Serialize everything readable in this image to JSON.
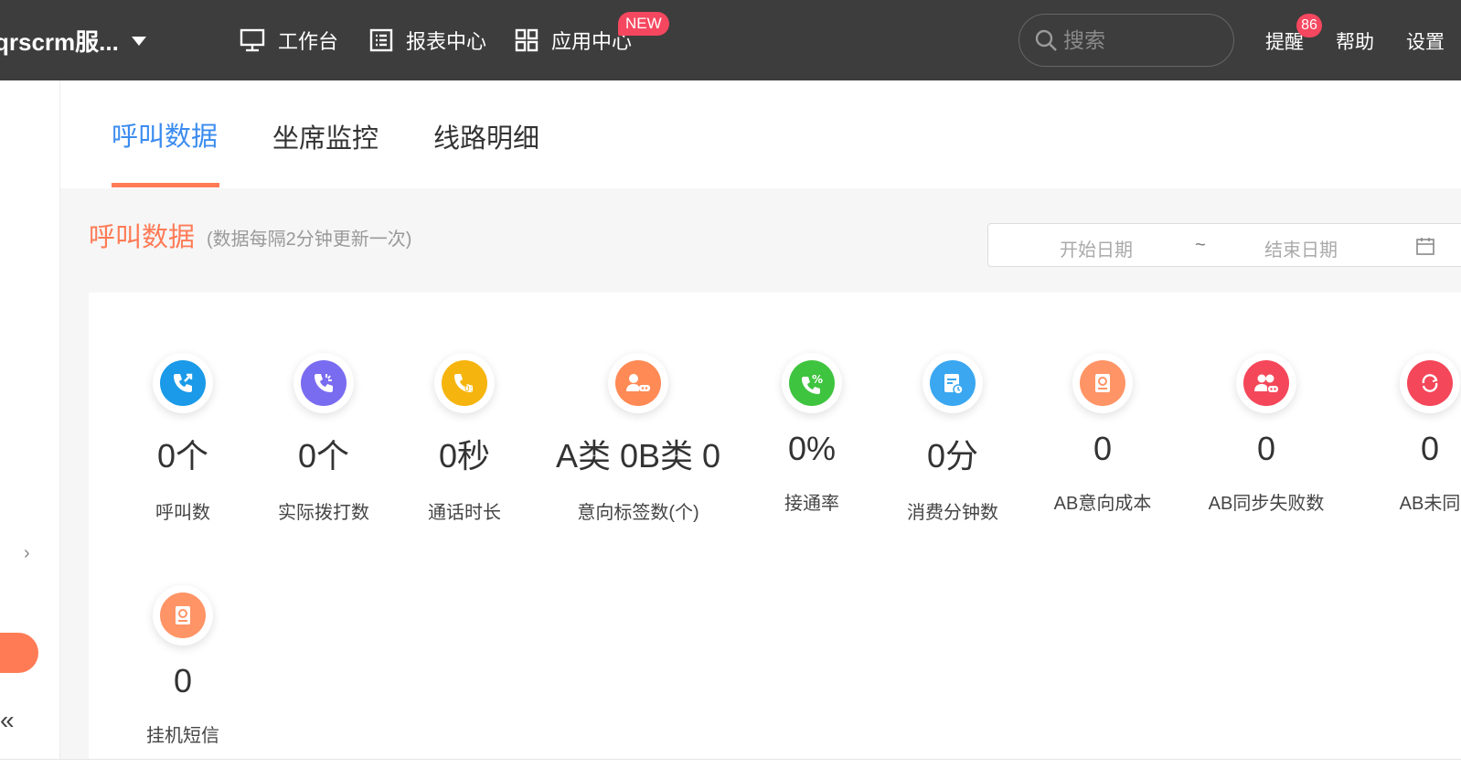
{
  "header": {
    "org_name": "qrscrm服...",
    "nav": [
      {
        "label": "工作台",
        "icon": "monitor-icon"
      },
      {
        "label": "报表中心",
        "icon": "report-icon"
      },
      {
        "label": "应用中心",
        "icon": "apps-grid-icon"
      }
    ],
    "new_badge": "NEW",
    "search_placeholder": "搜索",
    "reminder_label": "提醒",
    "reminder_count": "86",
    "help_label": "帮助",
    "settings_label": "设置"
  },
  "tabs": [
    {
      "label": "呼叫数据",
      "active": true
    },
    {
      "label": "坐席监控",
      "active": false
    },
    {
      "label": "线路明细",
      "active": false
    }
  ],
  "section": {
    "title": "呼叫数据",
    "note": "(数据每隔2分钟更新一次)",
    "start_date_placeholder": "开始日期",
    "separator": "~",
    "end_date_placeholder": "结束日期"
  },
  "stats": [
    {
      "value": "0个",
      "label": "呼叫数",
      "icon": "outgoing-call-icon",
      "color": "#1a9ae8"
    },
    {
      "value": "0个",
      "label": "实际拨打数",
      "icon": "dial-call-icon",
      "color": "#7a6cf0"
    },
    {
      "value": "0秒",
      "label": "通话时长",
      "icon": "call-duration-icon",
      "color": "#f6b40e"
    },
    {
      "value": "A类 0B类 0",
      "label": "意向标签数(个)",
      "icon": "user-tag-icon",
      "color": "#ff8a55"
    },
    {
      "value": "0%",
      "label": "接通率",
      "icon": "connect-rate-icon",
      "color": "#3fc43f"
    },
    {
      "value": "0分",
      "label": "消费分钟数",
      "icon": "bill-minutes-icon",
      "color": "#3aa7f0"
    },
    {
      "value": "0",
      "label": "AB意向成本",
      "icon": "ab-cost-icon",
      "color": "#ff9466"
    },
    {
      "value": "0",
      "label": "AB同步失败数",
      "icon": "sync-fail-icon",
      "color": "#f4475a"
    },
    {
      "value": "0",
      "label": "AB未同",
      "icon": "unsync-icon",
      "color": "#f4475a"
    },
    {
      "value": "0",
      "label": "挂机短信",
      "icon": "hangup-sms-icon",
      "color": "#ff9466"
    }
  ],
  "sidebar": {
    "expand_glyph": "›",
    "collapse_glyph": "«"
  }
}
